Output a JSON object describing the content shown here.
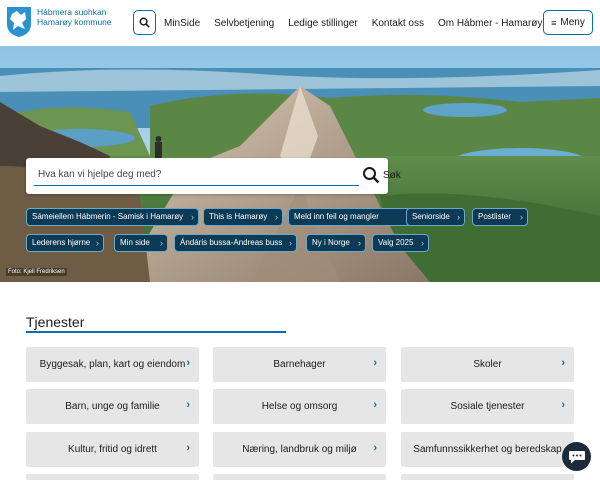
{
  "brand": {
    "line1": "Hábmera suohkan",
    "line2": "Hamarøy kommune"
  },
  "header": {
    "search_icon": "search-icon",
    "nav": [
      "MinSide",
      "Selvbetjening",
      "Ledige stillinger",
      "Kontakt oss",
      "Om Hábmer - Hamarøy"
    ],
    "menu_label": "Meny",
    "menu_icon": "hamburger-icon"
  },
  "hero": {
    "search_placeholder": "Hva kan vi hjelpe deg med?",
    "search_button": "Søk",
    "quicklinks": [
      "Sámeiellem Hábmerin - Samisk i Hamarøy",
      "This is Hamarøy",
      "Meld inn feil og mangler",
      "Seniorside",
      "Postlister",
      "Lederens hjørne",
      "Min side",
      "Ándáris bussa-Andreas buss",
      "Ny i Norge",
      "Valg 2025"
    ],
    "photo_credit": "Foto: Kjell Fredriksen"
  },
  "services": {
    "title": "Tjenester",
    "items": [
      "Byggesak, plan, kart og eiendom",
      "Barnehager",
      "Skoler",
      "Barn, unge og familie",
      "Helse og omsorg",
      "Sosiale tjenester",
      "Kultur, fritid og idrett",
      "Næring, landbruk og miljø",
      "Samfunnssikkerhet og beredskap"
    ]
  },
  "colors": {
    "accent": "#0a6ea8",
    "chip_bg": "#0d3a55",
    "card_bg": "#e6e6e6",
    "chat_bg": "#1c2a3a"
  },
  "chat_icon": "chat-icon"
}
